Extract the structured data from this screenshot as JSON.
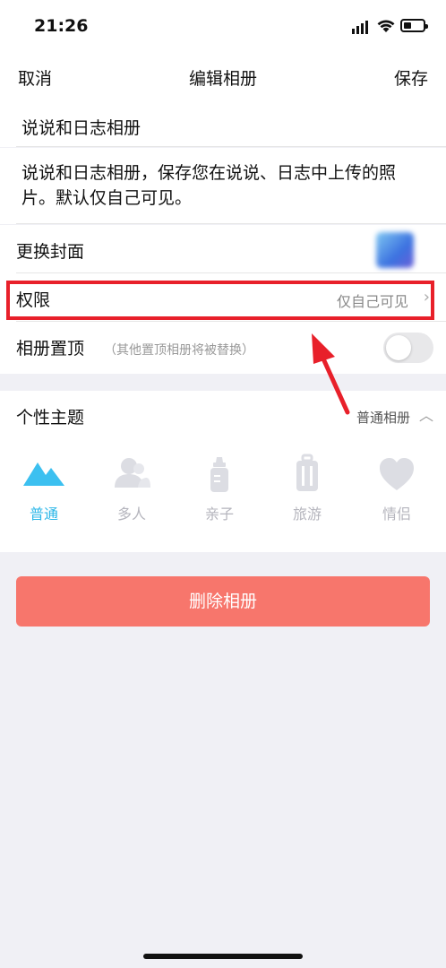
{
  "status_bar": {
    "time": "21:26"
  },
  "nav": {
    "cancel": "取消",
    "title": "编辑相册",
    "save": "保存"
  },
  "album": {
    "name": "说说和日志相册",
    "description": "说说和日志相册，保存您在说说、日志中上传的照片。默认仅自己可见。"
  },
  "settings": {
    "cover_label": "更换封面",
    "permission_label": "权限",
    "permission_value": "仅自己可见",
    "pin_label": "相册置顶",
    "pin_hint": "（其他置顶相册将被替换）",
    "pin_enabled": false
  },
  "theme": {
    "label": "个性主题",
    "value": "普通相册",
    "options": [
      {
        "label": "普通",
        "icon": "mountain-icon",
        "active": true
      },
      {
        "label": "多人",
        "icon": "people-icon",
        "active": false
      },
      {
        "label": "亲子",
        "icon": "baby-bottle-icon",
        "active": false
      },
      {
        "label": "旅游",
        "icon": "suitcase-icon",
        "active": false
      },
      {
        "label": "情侣",
        "icon": "heart-icon",
        "active": false
      }
    ]
  },
  "delete_button": "删除相册",
  "colors": {
    "accent": "#2db7e8",
    "delete": "#f7766c",
    "highlight": "#e8202a"
  }
}
